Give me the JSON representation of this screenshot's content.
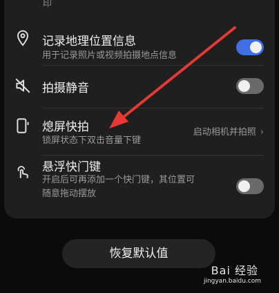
{
  "top_fragment": "印",
  "rows": [
    {
      "title": "记录地理位置信息",
      "subtitle": "用于记录照片或视频拍摄地点信息",
      "toggle_on": true,
      "icon": "location-pin-icon"
    },
    {
      "title": "拍摄静音",
      "subtitle": "",
      "toggle_on": false,
      "icon": "mute-icon"
    },
    {
      "title": "熄屏快拍",
      "subtitle": "锁屏状态下双击音量下键",
      "value": "启动相机并拍照",
      "icon": "volume-button-icon"
    },
    {
      "title": "悬浮快门键",
      "subtitle_line1": "开启后可再添加一个快门键，其位置可",
      "subtitle_line2": "随意拖动摆放",
      "toggle_on": false,
      "icon": "floating-shutter-icon"
    }
  ],
  "reset_button": "恢复默认值",
  "watermark": {
    "brand": "Bai 经验",
    "url": "jingyan.baidu.com"
  },
  "colors": {
    "accent": "#3f6fe3",
    "arrow": "#e53935"
  }
}
